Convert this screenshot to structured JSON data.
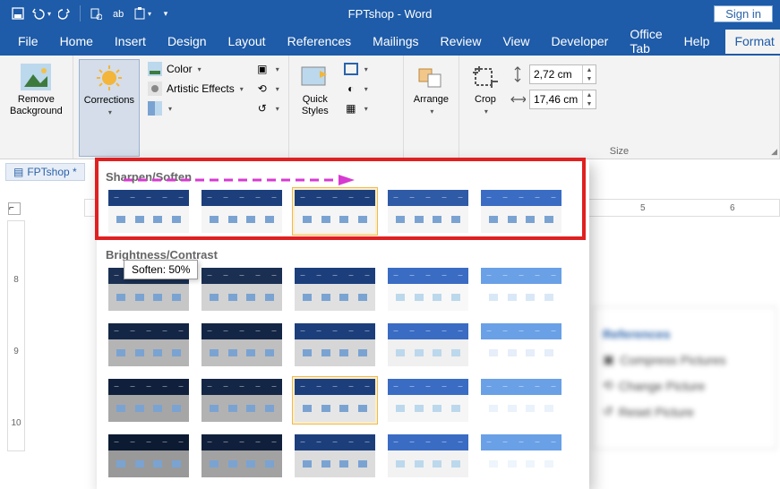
{
  "title": "FPTshop  -  Word",
  "signin": "Sign in",
  "menus": [
    "File",
    "Home",
    "Insert",
    "Design",
    "Layout",
    "References",
    "Mailings",
    "Review",
    "View",
    "Developer",
    "Office Tab",
    "Help",
    "Format"
  ],
  "active_menu": "Format",
  "ribbon": {
    "remove_bg": "Remove\nBackground",
    "corrections": "Corrections",
    "color_label": "Color",
    "artistic_label": "Artistic Effects",
    "quick_styles": "Quick\nStyles",
    "arrange": "Arrange",
    "crop": "Crop",
    "height": "2,72 cm",
    "width": "17,46 cm",
    "size_group": "Size"
  },
  "doc_tab": "FPTshop *",
  "hruler_marks": [
    "5",
    "6"
  ],
  "vruler_marks": [
    "8",
    "9",
    "10"
  ],
  "dropdown": {
    "sec1_title": "Sharpen/Soften",
    "sec2_title": "Brightness/Contrast",
    "tooltip": "Soften: 50%"
  },
  "colors": {
    "ribbon_blue": "#1e5ba8",
    "thumb_bars": [
      "#1c3f7c",
      "#1c3f7c",
      "#1c3f7c",
      "#2f5aa6",
      "#3a6cc4"
    ]
  },
  "blur_items": [
    "References",
    "Compress Pictures",
    "Change Picture",
    "Reset Picture"
  ]
}
